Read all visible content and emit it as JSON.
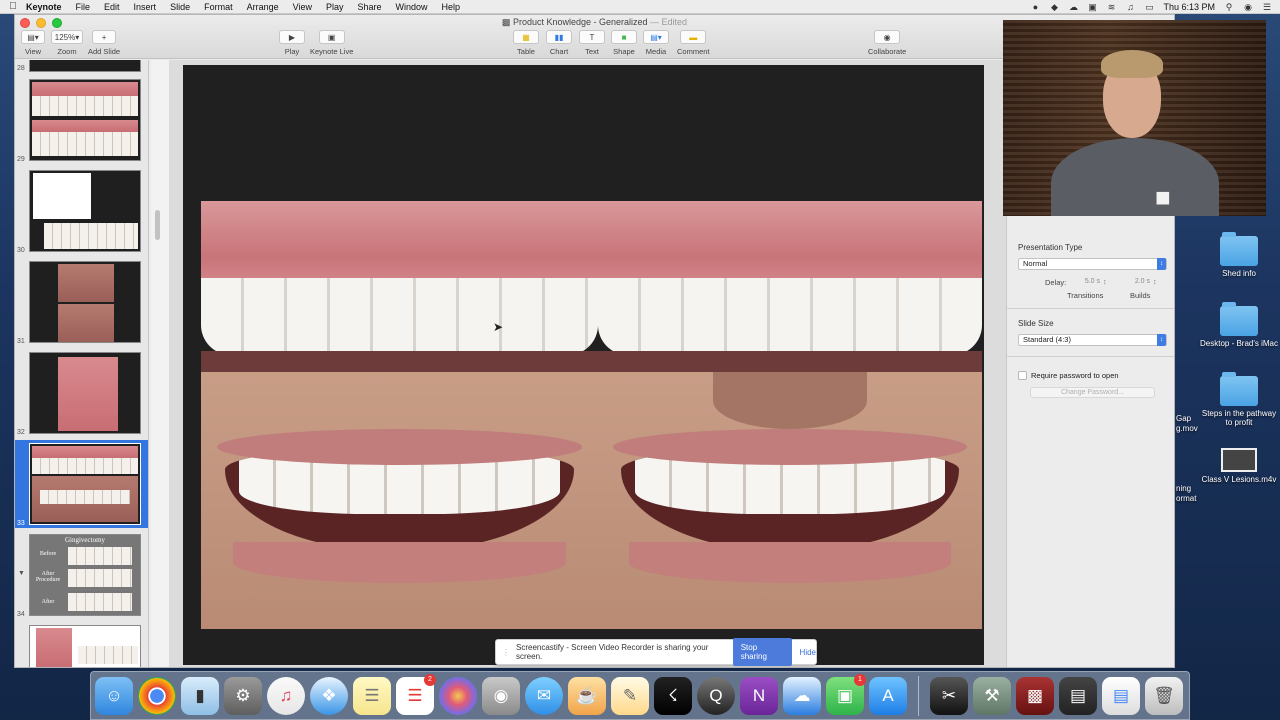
{
  "menubar": {
    "app_name": "Keynote",
    "menus": [
      "File",
      "Edit",
      "Insert",
      "Slide",
      "Format",
      "Arrange",
      "View",
      "Play",
      "Share",
      "Window",
      "Help"
    ],
    "clock": "Thu 6:13 PM"
  },
  "window": {
    "doc_title": "Product Knowledge - Generalized",
    "edited_label": "— Edited"
  },
  "toolbar": {
    "view_label": "View",
    "zoom_value": "125%",
    "zoom_label": "Zoom",
    "add_slide_label": "Add Slide",
    "play_label": "Play",
    "keynote_live_label": "Keynote Live",
    "table_label": "Table",
    "chart_label": "Chart",
    "text_label": "Text",
    "shape_label": "Shape",
    "media_label": "Media",
    "comment_label": "Comment",
    "collaborate_label": "Collaborate"
  },
  "navigator": {
    "slide_numbers": [
      "28",
      "29",
      "30",
      "31",
      "32",
      "33",
      "34"
    ],
    "selected_slide": "33",
    "gingivectomy_title": "Gingivectomy",
    "gingivectomy_labels": [
      "Before",
      "After Procedure",
      "After"
    ]
  },
  "sharing_banner": {
    "message": "Screencastify - Screen Video Recorder is sharing your screen.",
    "stop_label": "Stop sharing",
    "hide_label": "Hide"
  },
  "inspector": {
    "presentation_type_label": "Presentation Type",
    "presentation_type_value": "Normal",
    "delay_label": "Delay:",
    "transitions_value": "5.0 s",
    "builds_value": "2.0 s",
    "transitions_label": "Transitions",
    "builds_label": "Builds",
    "slide_size_label": "Slide Size",
    "slide_size_value": "Standard (4:3)",
    "require_password_label": "Require password to open",
    "change_password_label": "Change Password..."
  },
  "desktop": {
    "icons": [
      {
        "label": "Shed info"
      },
      {
        "label": "Desktop - Brad's iMac"
      },
      {
        "label": "Steps in the pathway to profit"
      },
      {
        "label": "Class V Lesions.m4v"
      }
    ],
    "partial_labels": [
      "Gap",
      "g.mov",
      "ning",
      "ormat"
    ]
  },
  "dock": {
    "reminders_badge": "2",
    "facetime_badge": "1"
  },
  "colors": {
    "selection_blue": "#3476e0",
    "stop_button": "#4c7bdc"
  }
}
